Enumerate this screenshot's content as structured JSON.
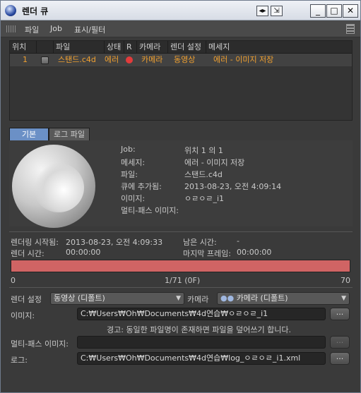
{
  "window": {
    "title": "렌더 큐"
  },
  "menu": {
    "items": [
      "파일",
      "Job",
      "표시/필터"
    ]
  },
  "queue": {
    "columns": [
      "위치",
      "",
      "파일",
      "상태",
      "R",
      "카메라",
      "렌더 설정",
      "메세지"
    ],
    "rows": [
      {
        "position": "1",
        "file": "스탠드.c4d",
        "status": "에러",
        "camera": "카메라",
        "render_setting": "동영상",
        "message": "에러 - 이미지 저장"
      }
    ]
  },
  "tabs": [
    "기본",
    "로그 파일"
  ],
  "info": {
    "job_label": "Job:",
    "job_value": "위치 1 의 1",
    "message_label": "메세지:",
    "message_value": "에러 - 이미지 저장",
    "file_label": "파일:",
    "file_value": "스탠드.c4d",
    "queued_label": "큐에 추가됨:",
    "queued_value": "2013-08-23, 오전 4:09:14",
    "image_label": "이미지:",
    "image_value": "ㅇㄹㅇㄹ_i1",
    "multipass_label": "멀티-패스 이미지:",
    "multipass_value": ""
  },
  "stats": {
    "render_start_label": "렌더링 시작됨:",
    "render_start_value": "2013-08-23, 오전 4:09:33",
    "remaining_label": "남은 시간:",
    "remaining_value": "-",
    "render_time_label": "렌더 시간:",
    "render_time_value": "00:00:00",
    "last_frame_label": "마지막 프레임:",
    "last_frame_value": "00:00:00"
  },
  "progress": {
    "fraction": 1.0,
    "min_label": "0",
    "center_label": "1/71 (0F)",
    "max_label": "70",
    "color": "#d06464"
  },
  "settings": {
    "render_setting_label": "렌더 설정",
    "render_setting_value": "동영상 (디폴트)",
    "camera_label": "카메라",
    "camera_value": "카메라 (디폴트)",
    "image_label": "이미지:",
    "image_path": "C:₩Users₩Oh₩Documents₩4d연습₩ㅇㄹㅇㄹ_i1",
    "warning": "경고: 동일한 파일명이 존재하면 파일을 덮어쓰기 합니다.",
    "multipass_label": "멀티-패스 이미지:",
    "multipass_path": "",
    "log_label": "로그:",
    "log_path": "C:₩Users₩Oh₩Documents₩4d연습₩log_ㅇㄹㅇㄹ_i1.xml",
    "browse_label": "..."
  },
  "title_buttons": {
    "min": "_",
    "max": "□",
    "close": "✕",
    "arrows": "◂▸",
    "dock": "⇲"
  }
}
